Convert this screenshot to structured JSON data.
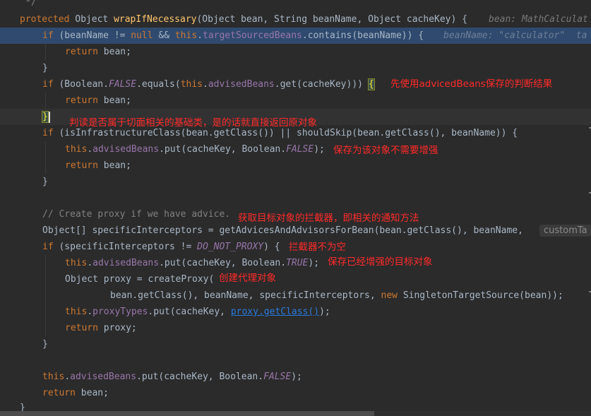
{
  "code": {
    "line0_comment": "*/",
    "line1": {
      "kw": "protected",
      "t1": " Object ",
      "fn": "wrapIfNecessary",
      "t2": "(Object bean, String beanName, Object cacheKey) {",
      "hint": "bean: MathCalculat"
    },
    "line2": {
      "kw1": "if",
      "t1": " (beanName != ",
      "kw2": "null",
      "t2": " && ",
      "kw3": "this",
      "t3": ".",
      "fld": "targetSourcedBeans",
      "t4": ".contains(beanName)) {",
      "hint": "beanName: \"calculator\"  ta"
    },
    "line3": {
      "kw": "return",
      "t1": " bean;"
    },
    "line4": "}",
    "line5": {
      "kw1": "if",
      "t1": " (Boolean.",
      "st": "FALSE",
      "t2": ".equals(",
      "kw2": "this",
      "t3": ".",
      "fld": "advisedBeans",
      "t4": ".get(cacheKey))) ",
      "brace": "{"
    },
    "line6": {
      "kw": "return",
      "t1": " bean;"
    },
    "line7": "}",
    "line8": {
      "kw": "if",
      "t1": " (isInfrastructureClass(bean.getClass()) || shouldSkip(bean.getClass(), beanName)) {"
    },
    "line9": {
      "kw": "this",
      "t1": ".",
      "fld": "advisedBeans",
      "t2": ".put(cacheKey, Boolean.",
      "st": "FALSE",
      "t3": ");"
    },
    "line10": {
      "kw": "return",
      "t1": " bean;"
    },
    "line11": "}",
    "line13_comment": "// Create proxy if we have advice.",
    "line14": {
      "t1": "Object[] specificInterceptors = getAdvicesAndAdvisorsForBean(bean.getClass(), beanName,",
      "inlay": "customTa"
    },
    "line15": {
      "kw": "if",
      "t1": " (specificInterceptors != ",
      "st": "DO_NOT_PROXY",
      "t2": ") {"
    },
    "line16": {
      "kw": "this",
      "t1": ".",
      "fld": "advisedBeans",
      "t2": ".put(cacheKey, Boolean.",
      "st": "TRUE",
      "t3": ");"
    },
    "line17": {
      "t1": "Object proxy = createProxy("
    },
    "line18": {
      "t1": "bean.getClass(), beanName, specificInterceptors, ",
      "kw": "new",
      "t2": " SingletonTargetSource(bean));"
    },
    "line19": {
      "kw": "this",
      "t1": ".",
      "fld": "proxyTypes",
      "t2": ".put(cacheKey, ",
      "link": "proxy.getClass()",
      "t3": ");"
    },
    "line20": {
      "kw": "return",
      "t1": " proxy;"
    },
    "line21": "}",
    "line23": {
      "kw": "this",
      "t1": ".",
      "fld": "advisedBeans",
      "t2": ".put(cacheKey, Boolean.",
      "st": "FALSE",
      "t3": ");"
    },
    "line24": {
      "kw": "return",
      "t1": " bean;"
    },
    "line25": "}"
  },
  "annotations": {
    "a1": "先使用advicedBeans保存的判断结果",
    "a2": "判读是否属于切面相关的基础类，是的话就直接返回原对象",
    "a3": "保存为该对象不需要增强",
    "a4": "获取目标对象的拦截器，即相关的通知方法",
    "a5": "拦截器不为空",
    "a6": "保存已经增强的目标对象",
    "a7": "创建代理对象"
  },
  "colors": {
    "background": "#2b2b2b",
    "keyword": "#cc7832",
    "method": "#ffc66d",
    "field": "#9876aa",
    "comment": "#808080",
    "annotation": "#ff2a2a",
    "selection": "#2f4a6e"
  }
}
